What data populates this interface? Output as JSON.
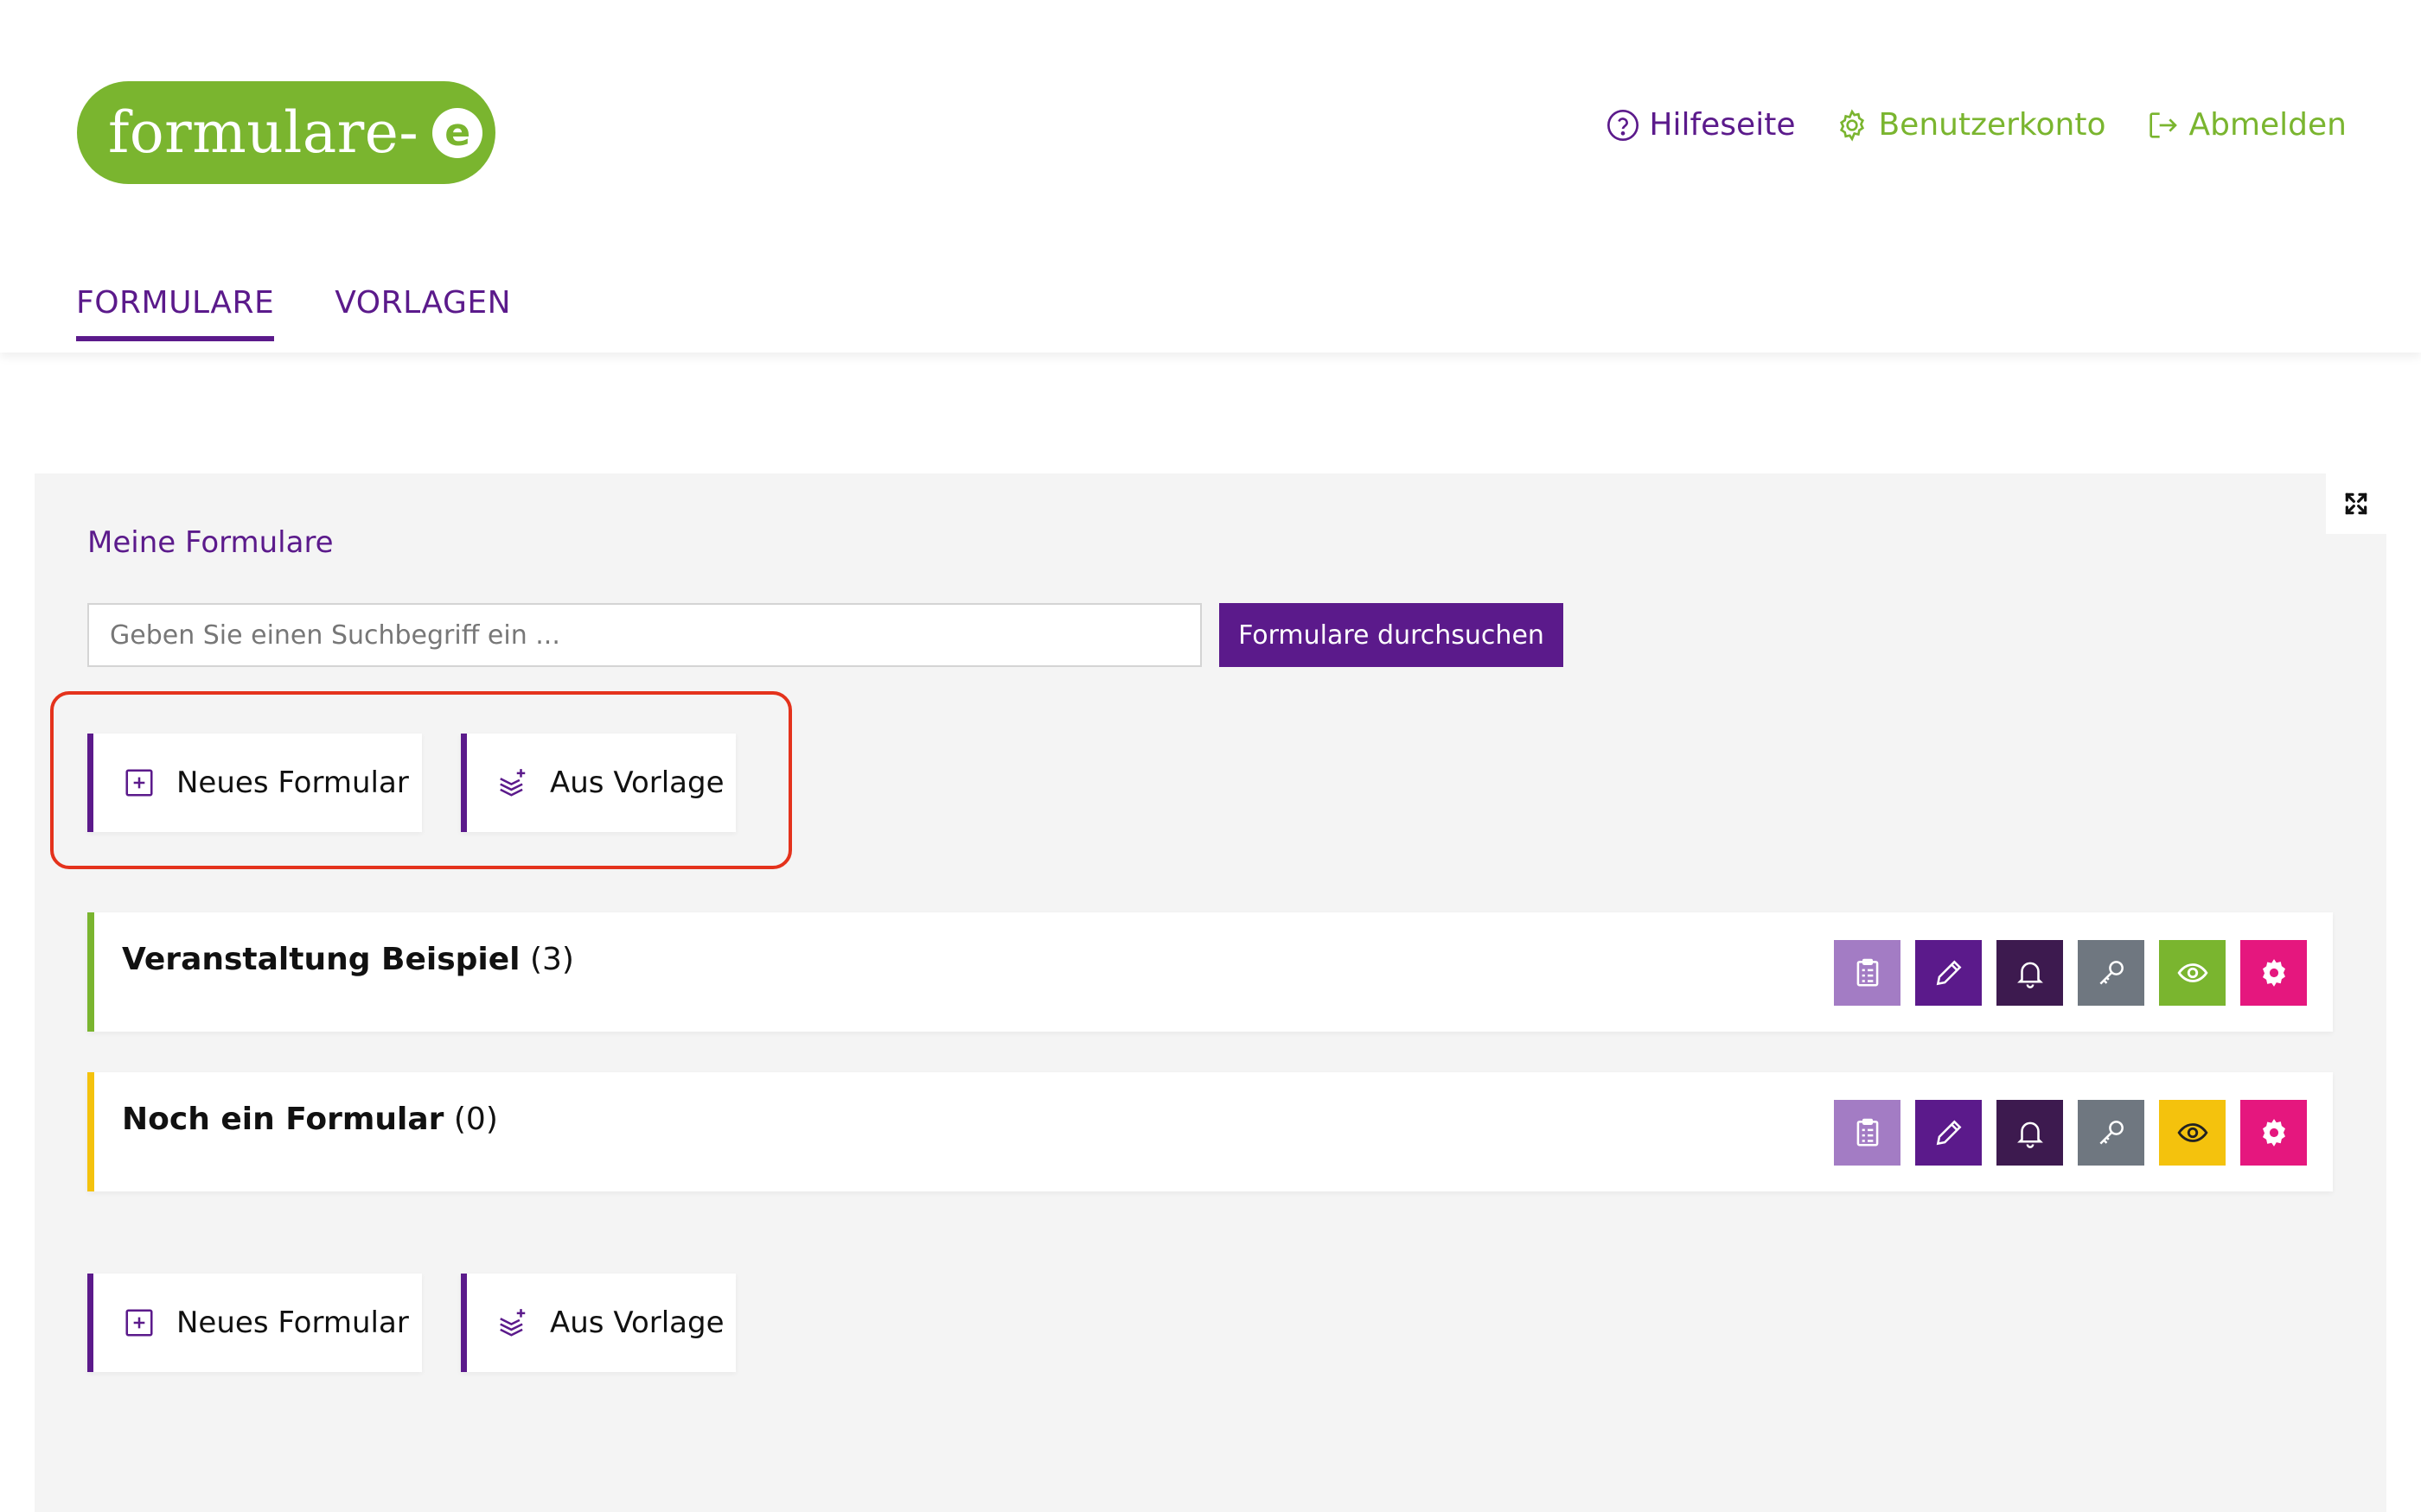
{
  "brand": {
    "name": "formulare-",
    "badge": "e"
  },
  "topnav": {
    "help": "Hilfeseite",
    "account": "Benutzerkonto",
    "logout": "Abmelden"
  },
  "tabs": [
    {
      "label": "FORMULARE",
      "active": true
    },
    {
      "label": "VORLAGEN",
      "active": false
    }
  ],
  "panel": {
    "title": "Meine Formulare",
    "search": {
      "placeholder": "Geben Sie einen Suchbegriff ein ...",
      "value": ""
    },
    "search_button": "Formulare durchsuchen",
    "actions": {
      "new_form": "Neues Formular",
      "from_template": "Aus Vorlage"
    },
    "forms": [
      {
        "name": "Veranstaltung Beispiel",
        "count": "(3)",
        "status_color": "#7ab52f"
      },
      {
        "name": "Noch ein Formular",
        "count": "(0)",
        "status_color": "#f4c20d"
      }
    ],
    "row_action_icons": [
      "clipboard-icon",
      "pencil-icon",
      "bell-icon",
      "key-icon",
      "eye-icon",
      "gear-icon"
    ]
  },
  "colors": {
    "primary_purple": "#5b1a8b",
    "brand_green": "#7ab52f",
    "yellow": "#f4c20d",
    "pink": "#e5177e",
    "highlight_red": "#e4321c"
  }
}
